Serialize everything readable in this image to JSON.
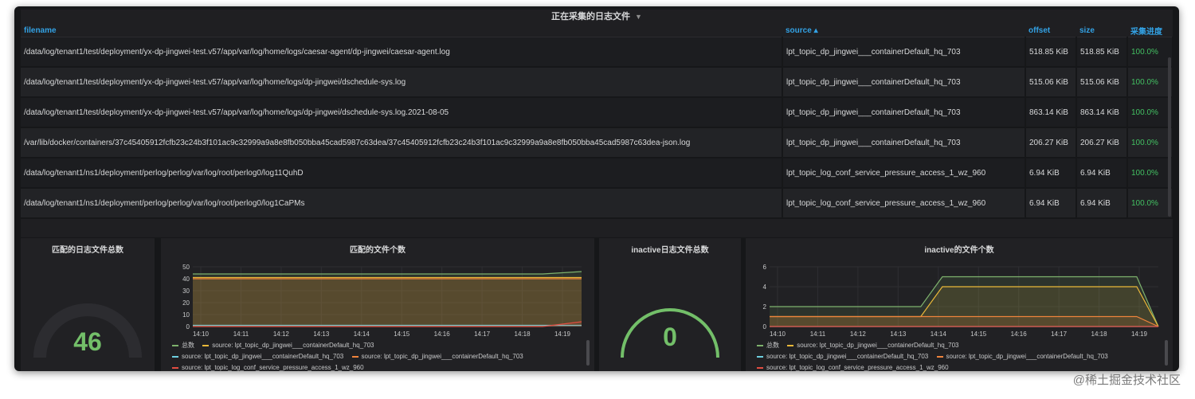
{
  "table": {
    "title": "正在采集的日志文件",
    "columns": [
      "filename",
      "source ▴",
      "offset",
      "size",
      "采集进度"
    ],
    "rows": [
      [
        "/data/log/tenant1/test/deployment/yx-dp-jingwei-test.v57/app/var/log/home/logs/caesar-agent/dp-jingwei/caesar-agent.log",
        "lpt_topic_dp_jingwei___containerDefault_hq_703",
        "518.85 KiB",
        "518.85 KiB",
        "100.0%"
      ],
      [
        "/data/log/tenant1/test/deployment/yx-dp-jingwei-test.v57/app/var/log/home/logs/dp-jingwei/dschedule-sys.log",
        "lpt_topic_dp_jingwei___containerDefault_hq_703",
        "515.06 KiB",
        "515.06 KiB",
        "100.0%"
      ],
      [
        "/data/log/tenant1/test/deployment/yx-dp-jingwei-test.v57/app/var/log/home/logs/dp-jingwei/dschedule-sys.log.2021-08-05",
        "lpt_topic_dp_jingwei___containerDefault_hq_703",
        "863.14 KiB",
        "863.14 KiB",
        "100.0%"
      ],
      [
        "/var/lib/docker/containers/37c45405912fcfb23c24b3f101ac9c32999a9a8e8fb050bba45cad5987c63dea/37c45405912fcfb23c24b3f101ac9c32999a9a8e8fb050bba45cad5987c63dea-json.log",
        "lpt_topic_dp_jingwei___containerDefault_hq_703",
        "206.27 KiB",
        "206.27 KiB",
        "100.0%"
      ],
      [
        "/data/log/tenant1/ns1/deployment/perlog/perlog/var/log/root/perlog0/log11QuhD",
        "lpt_topic_log_conf_service_pressure_access_1_wz_960",
        "6.94 KiB",
        "6.94 KiB",
        "100.0%"
      ],
      [
        "/data/log/tenant1/ns1/deployment/perlog/perlog/var/log/root/perlog0/log1CaPMs",
        "lpt_topic_log_conf_service_pressure_access_1_wz_960",
        "6.94 KiB",
        "6.94 KiB",
        "100.0%"
      ]
    ]
  },
  "stat1": {
    "title": "匹配的日志文件总数",
    "value": "46",
    "color": "#73bf69"
  },
  "stat2": {
    "title": "inactive日志文件总数",
    "value": "0",
    "color": "#73bf69"
  },
  "chart1": {
    "title": "匹配的文件个数"
  },
  "chart2": {
    "title": "inactive的文件个数"
  },
  "chart_data": [
    {
      "type": "line",
      "title": "匹配的文件个数",
      "x": [
        "14:10",
        "14:11",
        "14:12",
        "14:13",
        "14:14",
        "14:15",
        "14:16",
        "14:17",
        "14:18",
        "14:19"
      ],
      "ylim": [
        0,
        50
      ],
      "yticks": [
        0,
        10,
        20,
        30,
        40,
        50
      ],
      "series": [
        {
          "name": "总数",
          "color": "#7eb26d",
          "values": [
            44,
            44,
            44,
            44,
            44,
            44,
            44,
            44,
            44,
            44,
            46
          ]
        },
        {
          "name": "source: lpt_topic_dp_jingwei___containerDefault_hq_703",
          "color": "#eab839",
          "values": [
            41,
            41,
            41,
            41,
            41,
            41,
            41,
            41,
            41,
            41,
            41
          ]
        },
        {
          "name": "source: lpt_topic_dp_jingwei___containerDefault_hq_703",
          "color": "#6ed0e0",
          "values": [
            1,
            1,
            1,
            1,
            1,
            1,
            1,
            1,
            1,
            1,
            1
          ]
        },
        {
          "name": "source: lpt_topic_dp_jingwei___containerDefault_hq_703",
          "color": "#ef843c",
          "values": [
            40,
            40,
            40,
            40,
            40,
            40,
            40,
            40,
            40,
            40,
            40
          ]
        },
        {
          "name": "source: lpt_topic_log_conf_service_pressure_access_1_wz_960",
          "color": "#e24d42",
          "values": [
            0,
            0,
            0,
            0,
            0,
            0,
            0,
            0,
            0,
            0,
            4
          ]
        }
      ]
    },
    {
      "type": "line",
      "title": "inactive的文件个数",
      "x": [
        "14:10",
        "14:11",
        "14:12",
        "14:13",
        "14:14",
        "14:15",
        "14:16",
        "14:17",
        "14:18",
        "14:19"
      ],
      "ylim": [
        0,
        6
      ],
      "yticks": [
        0,
        2,
        4,
        6
      ],
      "series": [
        {
          "name": "总数",
          "color": "#7eb26d",
          "values": [
            2,
            2,
            2,
            2,
            2,
            2,
            2,
            2,
            5,
            5,
            5,
            5,
            5,
            5,
            5,
            5,
            5,
            5,
            0
          ]
        },
        {
          "name": "source: lpt_topic_dp_jingwei___containerDefault_hq_703",
          "color": "#eab839",
          "values": [
            1,
            1,
            1,
            1,
            1,
            1,
            1,
            1,
            4,
            4,
            4,
            4,
            4,
            4,
            4,
            4,
            4,
            4,
            0
          ]
        },
        {
          "name": "source: lpt_topic_dp_jingwei___containerDefault_hq_703",
          "color": "#6ed0e0",
          "values": [
            0,
            0,
            0,
            0,
            0,
            0,
            0,
            0,
            0,
            0,
            0,
            0,
            0,
            0,
            0,
            0,
            0,
            0,
            0
          ]
        },
        {
          "name": "source: lpt_topic_dp_jingwei___containerDefault_hq_703",
          "color": "#ef843c",
          "values": [
            1,
            1,
            1,
            1,
            1,
            1,
            1,
            1,
            1,
            1,
            1,
            1,
            1,
            1,
            1,
            1,
            1,
            1,
            0
          ]
        },
        {
          "name": "source: lpt_topic_log_conf_service_pressure_access_1_wz_960",
          "color": "#e24d42",
          "values": [
            0,
            0,
            0,
            0,
            0,
            0,
            0,
            0,
            0,
            0,
            0,
            0,
            0,
            0,
            0,
            0,
            0,
            0,
            0
          ]
        }
      ]
    }
  ],
  "watermark": "@稀土掘金技术社区"
}
